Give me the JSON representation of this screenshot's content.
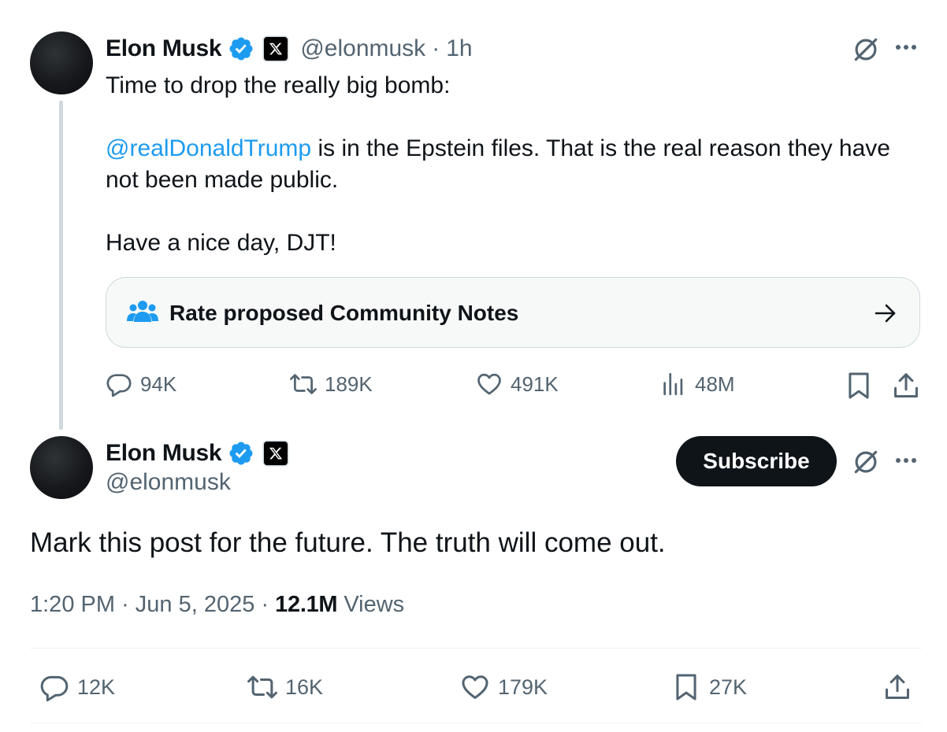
{
  "parent_post": {
    "author_name": "Elon Musk",
    "handle": "@elonmusk",
    "separator": "·",
    "time_ago": "1h",
    "line_1": "Time to drop the really big bomb:",
    "mention": "@realDonaldTrump",
    "line_2_rest": " is in the Epstein files. That is the real reason they have",
    "line_3": "not been made public.",
    "line_4": "Have a nice day, DJT!",
    "community_notes_label": "Rate proposed Community Notes",
    "metrics": {
      "replies": "94K",
      "reposts": "189K",
      "likes": "491K",
      "views": "48M"
    }
  },
  "main_post": {
    "author_name": "Elon Musk",
    "handle": "@elonmusk",
    "subscribe_label": "Subscribe",
    "text": "Mark this post for the future. The truth will come out.",
    "time": "1:20 PM",
    "date": "Jun 5, 2025",
    "dot": "·",
    "views_count": "12.1M",
    "views_label": "Views",
    "metrics": {
      "replies": "12K",
      "reposts": "16K",
      "likes": "179K",
      "bookmarks": "27K"
    }
  },
  "icons": {
    "verified": "verified-badge-icon",
    "affiliate": "x-logo-icon",
    "grok": "grok-icon",
    "more": "more-icon",
    "community": "people-icon",
    "arrow": "arrow-right-icon",
    "reply": "reply-icon",
    "repost": "repost-icon",
    "like": "heart-icon",
    "views": "views-icon",
    "bookmark": "bookmark-icon",
    "share": "share-icon"
  },
  "colors": {
    "accent": "#1d9bf0",
    "text": "#0f1419",
    "secondary": "#536471",
    "border": "#cfd9de"
  }
}
